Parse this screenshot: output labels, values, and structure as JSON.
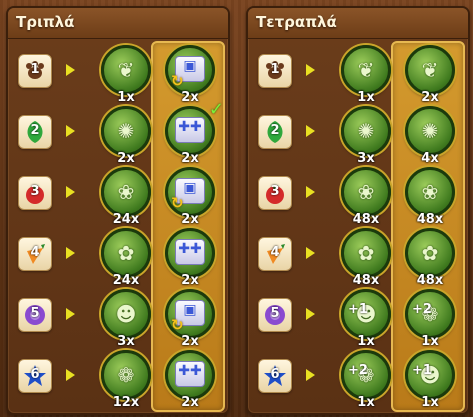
{
  "panels": [
    {
      "title": "Τριπλά",
      "rows": [
        {
          "tier": "1",
          "shape": "paw",
          "color": "#6b3a1c",
          "reward1": {
            "icon": "herb-bush-icon",
            "count": "1x",
            "plus": ""
          },
          "reward2": {
            "icon": "cube-cycle-icon",
            "count": "2x",
            "plus": "",
            "check": ""
          }
        },
        {
          "tier": "2",
          "shape": "leaf",
          "color": "#2fa83c",
          "reward1": {
            "icon": "thorn-plant-icon",
            "count": "2x",
            "plus": ""
          },
          "reward2": {
            "icon": "cube-plus-icon",
            "count": "2x",
            "plus": "",
            "check": "✓"
          }
        },
        {
          "tier": "3",
          "shape": "berry",
          "color": "#d42a2a",
          "reward1": {
            "icon": "red-flower-plant-icon",
            "count": "24x",
            "plus": ""
          },
          "reward2": {
            "icon": "cube-cycle-icon",
            "count": "2x",
            "plus": "",
            "check": ""
          }
        },
        {
          "tier": "4",
          "shape": "carrot",
          "color": "#f08a22",
          "reward1": {
            "icon": "green-pod-plant-icon",
            "count": "24x",
            "plus": ""
          },
          "reward2": {
            "icon": "cube-plus-icon",
            "count": "2x",
            "plus": "",
            "check": ""
          }
        },
        {
          "tier": "5",
          "shape": "flower",
          "color": "#8a4ad0",
          "reward1": {
            "icon": "robot-creature-icon",
            "count": "3x",
            "plus": ""
          },
          "reward2": {
            "icon": "cube-cycle-icon",
            "count": "2x",
            "plus": "",
            "check": ""
          }
        },
        {
          "tier": "6",
          "shape": "star",
          "color": "#1f4fc8",
          "reward1": {
            "icon": "hay-bundle-icon",
            "count": "12x",
            "plus": ""
          },
          "reward2": {
            "icon": "cube-plus-icon",
            "count": "2x",
            "plus": "",
            "check": ""
          }
        }
      ]
    },
    {
      "title": "Τετραπλά",
      "rows": [
        {
          "tier": "1",
          "shape": "paw",
          "color": "#6b3a1c",
          "reward1": {
            "icon": "herb-bush-icon",
            "count": "1x",
            "plus": ""
          },
          "reward2": {
            "icon": "herb-bush-icon",
            "count": "2x",
            "plus": "",
            "check": ""
          }
        },
        {
          "tier": "2",
          "shape": "leaf",
          "color": "#2fa83c",
          "reward1": {
            "icon": "thorn-plant-icon",
            "count": "3x",
            "plus": ""
          },
          "reward2": {
            "icon": "thorn-plant-icon",
            "count": "4x",
            "plus": "",
            "check": ""
          }
        },
        {
          "tier": "3",
          "shape": "berry",
          "color": "#d42a2a",
          "reward1": {
            "icon": "red-flower-plant-icon",
            "count": "48x",
            "plus": ""
          },
          "reward2": {
            "icon": "red-flower-plant-icon",
            "count": "48x",
            "plus": "",
            "check": ""
          }
        },
        {
          "tier": "4",
          "shape": "carrot",
          "color": "#f08a22",
          "reward1": {
            "icon": "green-pod-plant-icon",
            "count": "48x",
            "plus": ""
          },
          "reward2": {
            "icon": "green-pod-plant-icon",
            "count": "48x",
            "plus": "",
            "check": ""
          }
        },
        {
          "tier": "5",
          "shape": "flower",
          "color": "#8a4ad0",
          "reward1": {
            "icon": "robot-creature-icon",
            "count": "1x",
            "plus": "+1"
          },
          "reward2": {
            "icon": "hay-bundle-icon",
            "count": "1x",
            "plus": "+2",
            "check": ""
          }
        },
        {
          "tier": "6",
          "shape": "star",
          "color": "#1f4fc8",
          "reward1": {
            "icon": "hay-bundle-icon",
            "count": "1x",
            "plus": "+2"
          },
          "reward2": {
            "icon": "robot-creature-icon",
            "count": "1x",
            "plus": "+1",
            "check": ""
          }
        }
      ]
    }
  ]
}
